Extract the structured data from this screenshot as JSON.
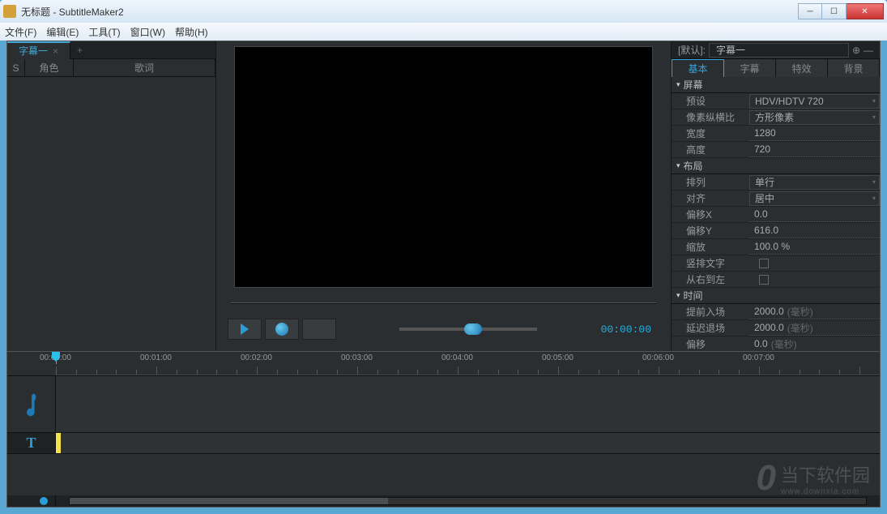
{
  "window": {
    "title": "无标题 - SubtitleMaker2"
  },
  "menu": {
    "file": "文件(F)",
    "edit": "编辑(E)",
    "tools": "工具(T)",
    "window": "窗口(W)",
    "help": "帮助(H)"
  },
  "left": {
    "tab": "字幕一",
    "col_s": "S",
    "col_role": "角色",
    "col_lyrics": "歌词"
  },
  "transport": {
    "timecode": "00:00:00"
  },
  "right": {
    "default_label": "[默认]:",
    "selection": "字幕一",
    "tabs": {
      "basic": "基本",
      "subtitle": "字幕",
      "fx": "特效",
      "bg": "背景"
    },
    "sections": {
      "screen": "屏幕",
      "layout": "布局",
      "time": "时间"
    },
    "props": {
      "preset_label": "预设",
      "preset_value": "HDV/HDTV 720",
      "aspect_label": "像素纵横比",
      "aspect_value": "方形像素",
      "width_label": "宽度",
      "width_value": "1280",
      "height_label": "高度",
      "height_value": "720",
      "arr_label": "排列",
      "arr_value": "单行",
      "align_label": "对齐",
      "align_value": "居中",
      "offx_label": "偏移X",
      "offx_value": "0.0",
      "offy_label": "偏移Y",
      "offy_value": "616.0",
      "scale_label": "缩放",
      "scale_value": "100.0 %",
      "vert_label": "竖排文字",
      "rtl_label": "从右到左",
      "prein_label": "提前入场",
      "prein_value": "2000.0",
      "ms_unit": "(毫秒)",
      "postout_label": "延迟退场",
      "postout_value": "2000.0",
      "toffset_label": "偏移",
      "toffset_value": "0.0"
    }
  },
  "timeline": {
    "labels": [
      "00:00:00",
      "00:01:00",
      "00:02:00",
      "00:03:00",
      "00:04:00",
      "00:05:00",
      "00:06:00",
      "00:07:00"
    ]
  },
  "watermark": {
    "brand": "当下软件园",
    "url": "www.downxia.com"
  }
}
